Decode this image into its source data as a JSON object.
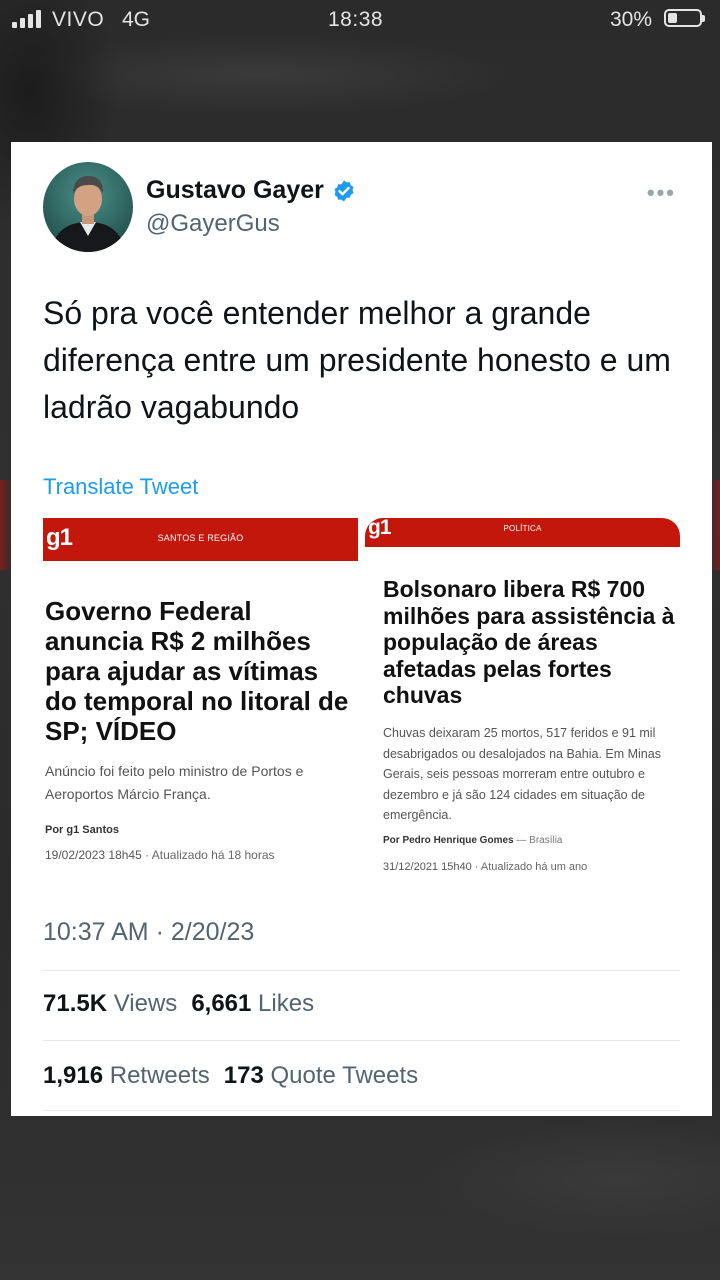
{
  "status_bar": {
    "carrier": "VIVO",
    "network": "4G",
    "time": "18:38",
    "battery_percent": "30%",
    "battery_level": 0.3
  },
  "tweet": {
    "display_name": "Gustavo Gayer",
    "handle": "@GayerGus",
    "verified": true,
    "more_icon": "more-icon",
    "text": "Só pra você entender melhor a grande diferença entre um presidente honesto e um ladrão vagabundo",
    "translate_label": "Translate Tweet",
    "timestamp": "10:37 AM · 2/20/23",
    "views_count": "71.5K",
    "views_label": "Views",
    "likes_count": "6,661",
    "likes_label": "Likes",
    "retweets_count": "1,916",
    "retweets_label": "Retweets",
    "quotes_count": "173",
    "quotes_label": "Quote Tweets",
    "accent_color": "#1d9bf0"
  },
  "news_left": {
    "logo": "g1",
    "section": "SANTOS E REGIÃO",
    "title": "Governo Federal anuncia R$ 2 milhões para ajudar as vítimas do temporal no litoral de SP; VÍDEO",
    "subtitle": "Anúncio foi feito pelo ministro de Portos e Aeroportos Márcio França.",
    "author": "Por g1 Santos",
    "date": "19/02/2023 18h45",
    "updated": " · Atualizado há 18 horas",
    "brand_color": "#c4170c"
  },
  "news_right": {
    "logo": "g1",
    "section": "POLÍTICA",
    "title": "Bolsonaro libera R$ 700 milhões para assistência à população de áreas afetadas pelas fortes chuvas",
    "subtitle": "Chuvas deixaram 25 mortos, 517 feridos e 91 mil desabrigados ou desalojados na Bahia. Em Minas Gerais, seis pessoas morreram entre outubro e dezembro e já são 124 cidades em situação de emergência.",
    "author": "Por Pedro Henrique Gomes",
    "place": " — Brasília",
    "date": "31/12/2021 15h40",
    "updated": " · Atualizado há um ano",
    "brand_color": "#c4170c"
  }
}
